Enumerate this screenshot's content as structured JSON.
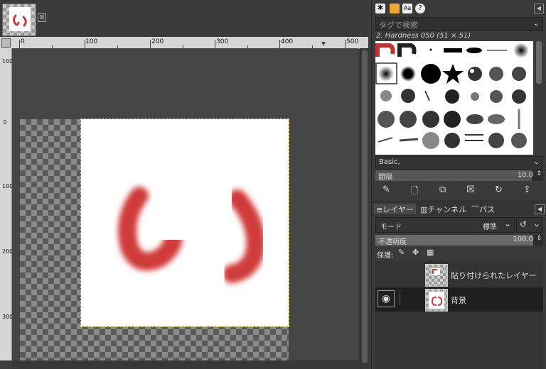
{
  "image_tab": {
    "close_symbol": "⊠",
    "thumb_icon": "image-thumbnail"
  },
  "ruler_h": {
    "labels": [
      "0",
      "100",
      "200",
      "300",
      "400",
      "500"
    ]
  },
  "ruler_v": {
    "labels": [
      "100",
      "0",
      "100",
      "200",
      "300"
    ]
  },
  "brushes": {
    "search_placeholder": "タグで検索",
    "selected_name": "2. Hardness 050 (51 × 51)",
    "tag_value": "Basic,",
    "spacing_label": "間隔",
    "spacing_value": "10.0"
  },
  "layers_panel": {
    "tabs": [
      "レイヤー",
      "チャンネル",
      "パス"
    ],
    "mode_label": "モード",
    "mode_value": "標準",
    "opacity_label": "不透明度",
    "opacity_value": "100.0",
    "lock_label": "保護:",
    "layers": [
      {
        "name": "貼り付けられたレイヤー",
        "visible": false,
        "selected": false
      },
      {
        "name": "背景",
        "visible": true,
        "selected": true
      }
    ]
  },
  "colors": {
    "accent_red": "#d03a3a",
    "selection_marching_ants": "#e6d23a",
    "dock_bg": "#3a3a3a"
  }
}
